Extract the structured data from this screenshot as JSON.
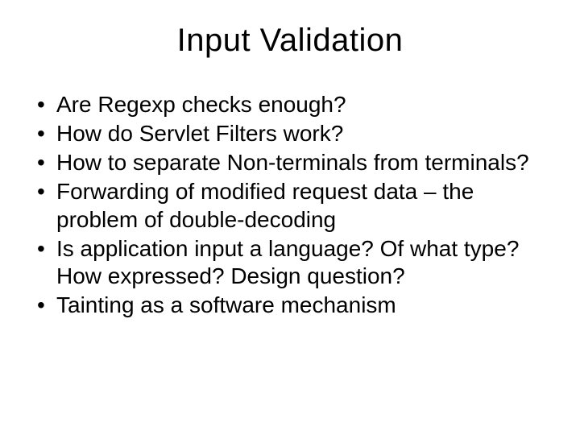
{
  "slide": {
    "title": "Input Validation",
    "bullets": [
      "Are Regexp checks enough?",
      "How do Servlet Filters work?",
      "How to separate Non-terminals from terminals?",
      "Forwarding of modified request data – the problem of double-decoding",
      "Is application input a language? Of what type? How expressed? Design question?",
      "Tainting as a software mechanism"
    ]
  }
}
